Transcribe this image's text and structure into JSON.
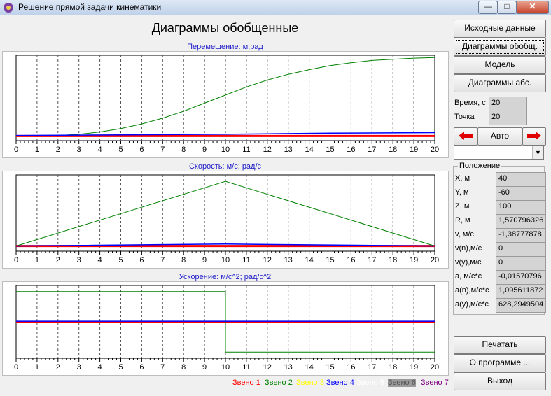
{
  "window": {
    "title": "Решение прямой задачи кинематики",
    "min": "—",
    "max": "□",
    "close": "✕"
  },
  "main_title": "Диаграммы обобщенные",
  "plots": {
    "displacement": {
      "title": "Перемещение: м;рад"
    },
    "velocity": {
      "title": "Скорость: м/с; рад/с"
    },
    "acceleration": {
      "title": "Ускорение: м/с^2; рад/с^2"
    }
  },
  "x_ticks": [
    "0",
    "1",
    "2",
    "3",
    "4",
    "5",
    "6",
    "7",
    "8",
    "9",
    "10",
    "11",
    "12",
    "13",
    "14",
    "15",
    "16",
    "17",
    "18",
    "19",
    "20"
  ],
  "buttons": {
    "source_data": "Исходные данные",
    "gen_diagrams": "Диаграммы обобщ.",
    "model": "Модель",
    "abs_diagrams": "Диаграммы абс.",
    "auto": "Авто",
    "print": "Печатать",
    "about": "О программе ...",
    "exit": "Выход"
  },
  "time": {
    "label": "Время, с",
    "value": "20"
  },
  "point": {
    "label": "Точка",
    "value": "20"
  },
  "dropdown_value": "",
  "position_group": {
    "title": "Положение",
    "rows": [
      {
        "label": "X, м",
        "value": "40"
      },
      {
        "label": "Y, м",
        "value": "-60"
      },
      {
        "label": "Z, м",
        "value": "100"
      },
      {
        "label": "R, м",
        "value": "1,570796326"
      },
      {
        "label": "v, м/с",
        "value": "-1,38777878"
      },
      {
        "label": "v(n),м/с",
        "value": "0"
      },
      {
        "label": "v(y),м/с",
        "value": "0"
      },
      {
        "label": "a, м/с*с",
        "value": "-0,01570796"
      },
      {
        "label": "a(n),м/с*с",
        "value": "1,095611872"
      },
      {
        "label": "a(y),м/с*с",
        "value": "628,2949504"
      }
    ]
  },
  "legend": [
    {
      "label": "Звено 1",
      "color": "#ff0000"
    },
    {
      "label": "Звено 2",
      "color": "#008000"
    },
    {
      "label": "Звено 3",
      "color": "#ffff00"
    },
    {
      "label": "Звено 4",
      "color": "#0000ff"
    },
    {
      "label": "Звено 5",
      "color": "#ffffff"
    },
    {
      "label": "Звено 6",
      "color": "#808080"
    },
    {
      "label": "Звено 7",
      "color": "#800080"
    }
  ],
  "chart_data": [
    {
      "type": "line",
      "title": "Перемещение: м;рад",
      "xlim": [
        0,
        20
      ],
      "series": [
        {
          "name": "Звено 1",
          "color": "#ff0000",
          "x": [
            0,
            20
          ],
          "y": [
            0,
            0
          ]
        },
        {
          "name": "Звено 2",
          "color": "#008000",
          "x": [
            1.5,
            2,
            3,
            4,
            5,
            6,
            7,
            8,
            9,
            10,
            11,
            12,
            13,
            14,
            15,
            16,
            17,
            18,
            19,
            20
          ],
          "y": [
            0,
            0.01,
            0.03,
            0.07,
            0.13,
            0.21,
            0.31,
            0.43,
            0.57,
            0.71,
            0.85,
            0.97,
            1.07,
            1.15,
            1.22,
            1.27,
            1.31,
            1.33,
            1.35,
            1.36
          ]
        },
        {
          "name": "Звено 4",
          "color": "#0000ff",
          "x": [
            0,
            5,
            10,
            15,
            20
          ],
          "y": [
            0.01,
            0.02,
            0.03,
            0.05,
            0.06
          ]
        }
      ]
    },
    {
      "type": "line",
      "title": "Скорость: м/с; рад/с",
      "xlim": [
        0,
        20
      ],
      "series": [
        {
          "name": "Звено 1",
          "color": "#ff0000",
          "x": [
            0,
            20
          ],
          "y": [
            0,
            0
          ]
        },
        {
          "name": "Звено 2",
          "color": "#008000",
          "x": [
            0,
            10,
            20
          ],
          "y": [
            0,
            1,
            0
          ]
        },
        {
          "name": "Звено 4",
          "color": "#0000ff",
          "x": [
            0,
            10,
            20
          ],
          "y": [
            0,
            0.03,
            0
          ]
        }
      ]
    },
    {
      "type": "line",
      "title": "Ускорение: м/с^2; рад/с^2",
      "xlim": [
        0,
        20
      ],
      "series": [
        {
          "name": "Звено 1",
          "color": "#ff0000",
          "x": [
            0,
            20
          ],
          "y": [
            0,
            0
          ]
        },
        {
          "name": "Звено 2",
          "color": "#008000",
          "x": [
            0,
            10,
            10,
            20
          ],
          "y": [
            1,
            1,
            -1,
            -1
          ]
        },
        {
          "name": "Звено 4",
          "color": "#0000ff",
          "x": [
            0,
            20
          ],
          "y": [
            0.02,
            0.02
          ]
        }
      ]
    }
  ]
}
